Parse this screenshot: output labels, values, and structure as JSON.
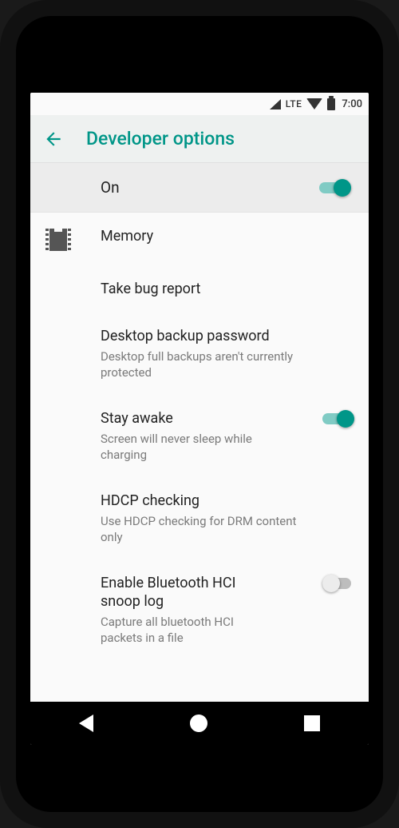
{
  "status": {
    "network_label": "LTE",
    "clock": "7:00"
  },
  "appbar": {
    "title": "Developer options"
  },
  "master": {
    "label": "On",
    "enabled": true
  },
  "items": [
    {
      "id": "memory",
      "title": "Memory",
      "sub": "",
      "icon": "chip-icon",
      "toggle": null
    },
    {
      "id": "bugreport",
      "title": "Take bug report",
      "sub": "",
      "icon": "",
      "toggle": null
    },
    {
      "id": "backup-pw",
      "title": "Desktop backup password",
      "sub": "Desktop full backups aren't currently protected",
      "icon": "",
      "toggle": null
    },
    {
      "id": "stay-awake",
      "title": "Stay awake",
      "sub": "Screen will never sleep while charging",
      "icon": "",
      "toggle": true
    },
    {
      "id": "hdcp",
      "title": "HDCP checking",
      "sub": "Use HDCP checking for DRM content only",
      "icon": "",
      "toggle": null
    },
    {
      "id": "bt-snoop",
      "title": "Enable Bluetooth HCI snoop log",
      "sub": "Capture all bluetooth HCI packets in a file",
      "icon": "",
      "toggle": false
    }
  ]
}
